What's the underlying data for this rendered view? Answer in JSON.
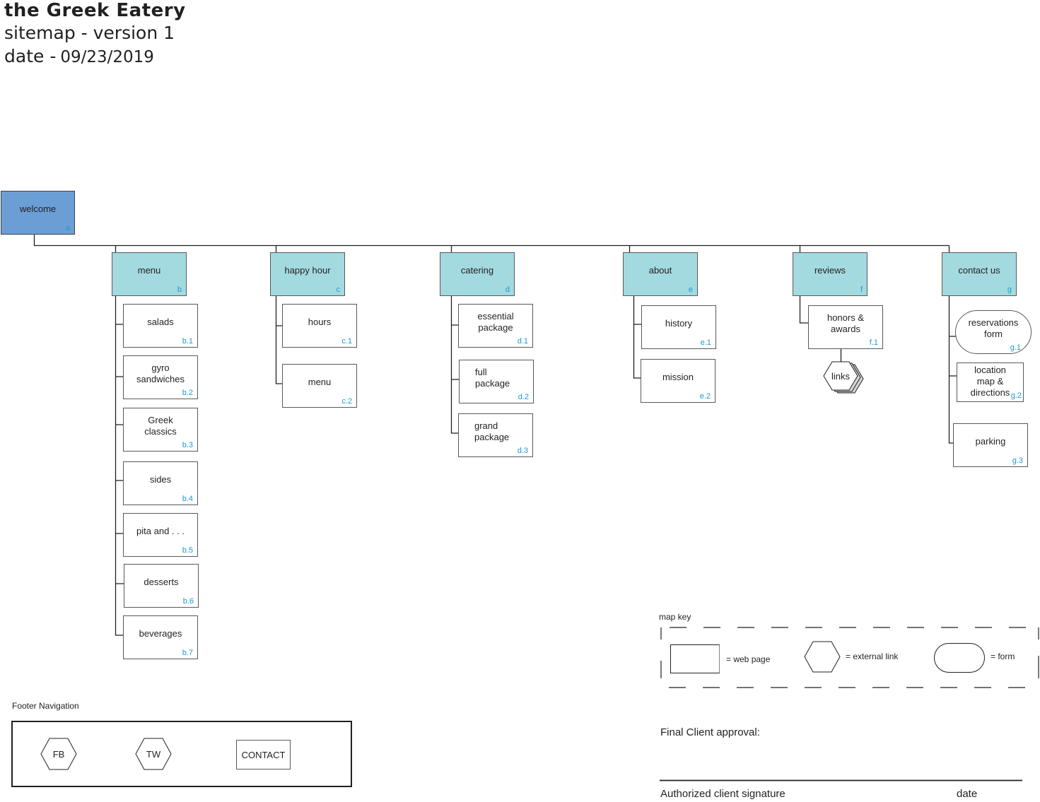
{
  "header": {
    "title": "the Greek Eatery",
    "subtitle": "sitemap - version 1",
    "date_label": "date -",
    "date_value": "09/23/2019"
  },
  "colors": {
    "root_fill": "#6c9ed6",
    "level1_fill": "#a2dadf",
    "code_text": "#1b9ad6",
    "line": "#231f20"
  },
  "sitemap": {
    "root": {
      "label": "welcome",
      "code": "a"
    },
    "sections": [
      {
        "label": "menu",
        "code": "b",
        "children": [
          {
            "label": "salads",
            "code": "b.1",
            "type": "page"
          },
          {
            "label": "gyro sandwiches",
            "code": "b.2",
            "type": "page"
          },
          {
            "label": "Greek classics",
            "code": "b.3",
            "type": "page"
          },
          {
            "label": "sides",
            "code": "b.4",
            "type": "page"
          },
          {
            "label": "pita and . . .",
            "code": "b.5",
            "type": "page"
          },
          {
            "label": "desserts",
            "code": "b.6",
            "type": "page"
          },
          {
            "label": "beverages",
            "code": "b.7",
            "type": "page"
          }
        ]
      },
      {
        "label": "happy hour",
        "code": "c",
        "children": [
          {
            "label": "hours",
            "code": "c.1",
            "type": "page"
          },
          {
            "label": "menu",
            "code": "c.2",
            "type": "page"
          }
        ]
      },
      {
        "label": "catering",
        "code": "d",
        "children": [
          {
            "label": "essential package",
            "code": "d.1",
            "type": "page"
          },
          {
            "label": "full package",
            "code": "d.2",
            "type": "page"
          },
          {
            "label": "grand package",
            "code": "d.3",
            "type": "page"
          }
        ]
      },
      {
        "label": "about",
        "code": "e",
        "children": [
          {
            "label": "history",
            "code": "e.1",
            "type": "page"
          },
          {
            "label": "mission",
            "code": "e.2",
            "type": "page"
          }
        ]
      },
      {
        "label": "reviews",
        "code": "f",
        "children": [
          {
            "label": "honors & awards",
            "code": "f.1",
            "type": "page",
            "external": {
              "label": "links",
              "type": "external-link-stack"
            }
          }
        ]
      },
      {
        "label": "contact us",
        "code": "g",
        "children": [
          {
            "label": "reservations form",
            "code": "g.1",
            "type": "form"
          },
          {
            "label": "location map & directions",
            "code": "g.2",
            "type": "page"
          },
          {
            "label": "parking",
            "code": "g.3",
            "type": "page"
          }
        ]
      }
    ]
  },
  "map_key": {
    "title": "map key",
    "items": [
      {
        "shape": "rectangle",
        "label": "= web page"
      },
      {
        "shape": "hexagon",
        "label": "= external link"
      },
      {
        "shape": "rounded",
        "label": "= form"
      }
    ]
  },
  "footer_navigation": {
    "title": "Footer Navigation",
    "items": [
      {
        "label": "FB",
        "shape": "hexagon"
      },
      {
        "label": "TW",
        "shape": "hexagon"
      },
      {
        "label": "CONTACT",
        "shape": "rectangle"
      }
    ]
  },
  "approval": {
    "title": "Final Client approval:",
    "signature_label": "Authorized client signature",
    "date_label": "date"
  }
}
